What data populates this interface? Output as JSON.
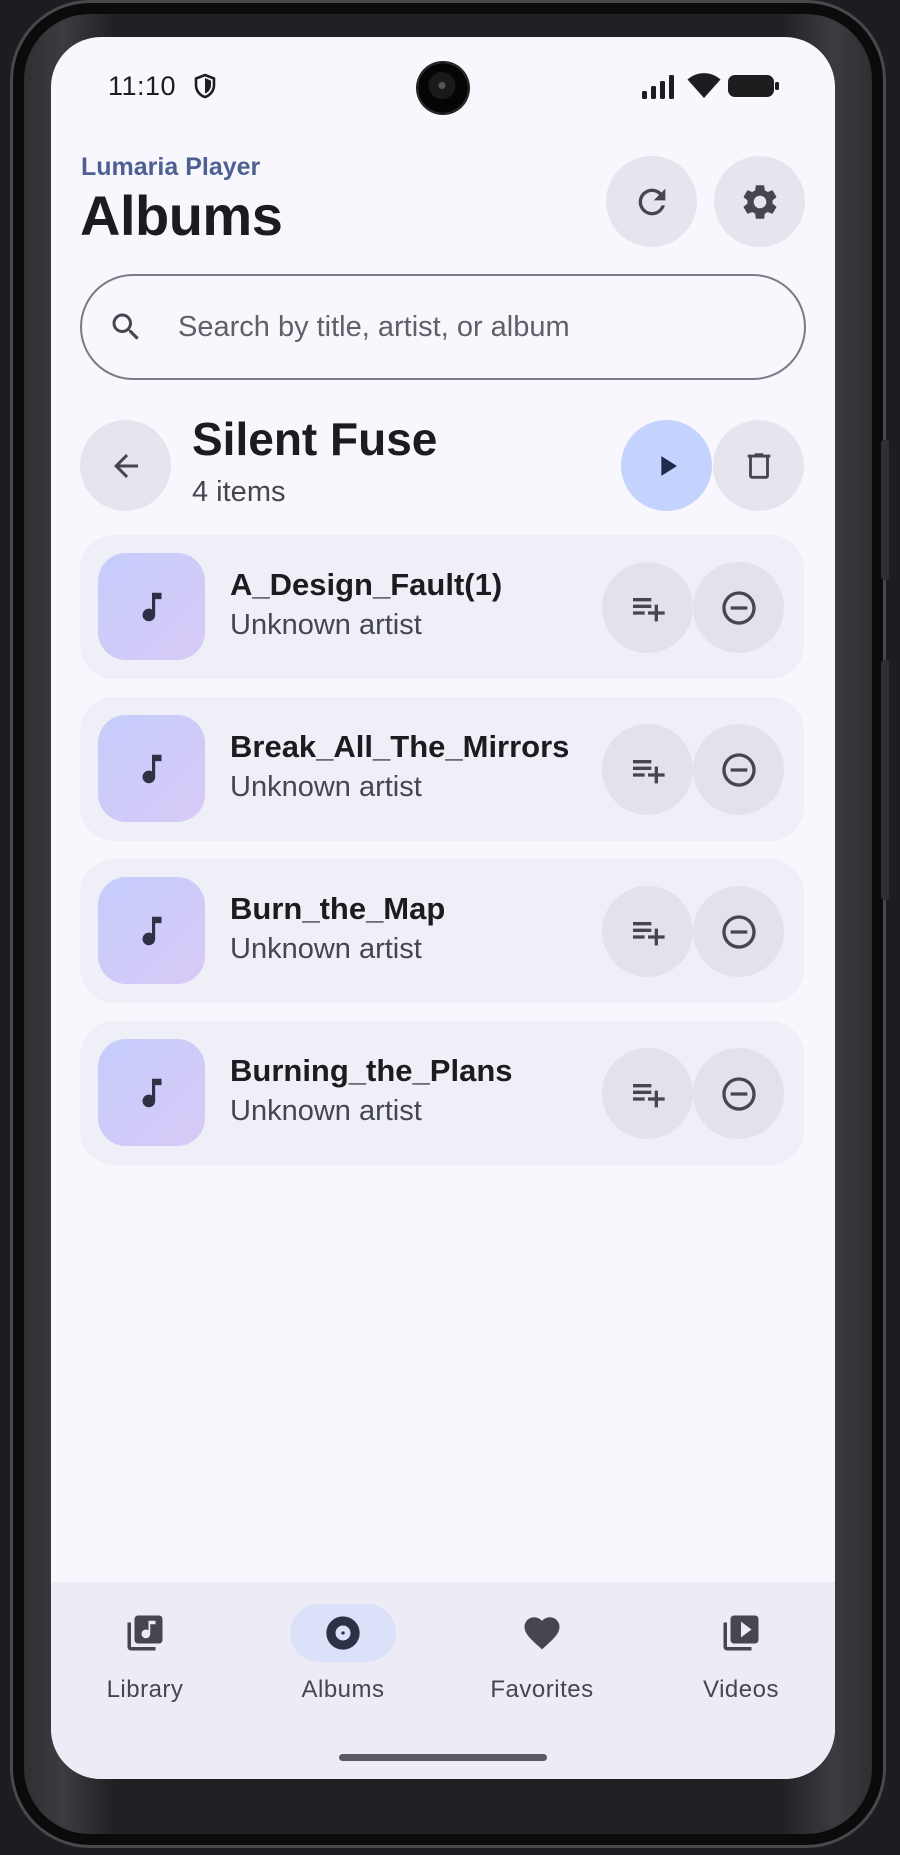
{
  "status_bar": {
    "time": "11:10"
  },
  "header": {
    "app_name": "Lumaria Player",
    "page_title": "Albums"
  },
  "search": {
    "placeholder": "Search by title, artist, or album",
    "value": ""
  },
  "album": {
    "name": "Silent Fuse",
    "count": "4 items"
  },
  "tracks": [
    {
      "title": "A_Design_Fault(1)",
      "artist": "Unknown artist"
    },
    {
      "title": "Break_All_The_Mirrors",
      "artist": "Unknown artist"
    },
    {
      "title": "Burn_the_Map",
      "artist": "Unknown artist"
    },
    {
      "title": "Burning_the_Plans",
      "artist": "Unknown artist"
    }
  ],
  "bottom_nav": [
    {
      "label": "Library",
      "icon": "library-music-icon",
      "active": false
    },
    {
      "label": "Albums",
      "icon": "album-icon",
      "active": true
    },
    {
      "label": "Favorites",
      "icon": "heart-icon",
      "active": false
    },
    {
      "label": "Videos",
      "icon": "video-library-icon",
      "active": false
    }
  ],
  "colors": {
    "accent": "#4e5f92",
    "primary_button": "#c3d3fd",
    "background": "#f8f7fd",
    "active_nav_pill": "#dbe1f8"
  }
}
